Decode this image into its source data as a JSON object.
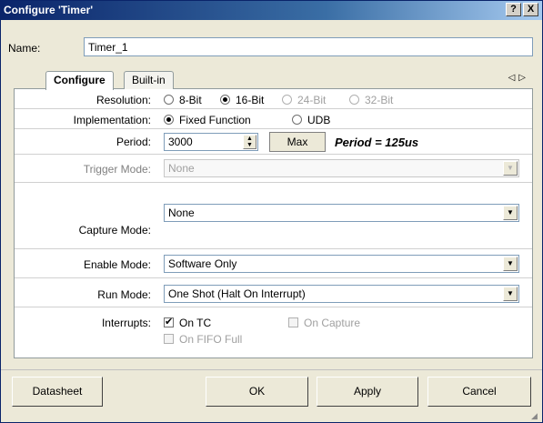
{
  "window": {
    "title": "Configure 'Timer'",
    "help_label": "?",
    "close_label": "X"
  },
  "name": {
    "label": "Name:",
    "value": "Timer_1"
  },
  "tabs": [
    {
      "label": "Configure"
    },
    {
      "label": "Built-in"
    }
  ],
  "tab_scroll": {
    "left": "◁",
    "right": "▷"
  },
  "rows": {
    "resolution": {
      "label": "Resolution:",
      "options": [
        "8-Bit",
        "16-Bit",
        "24-Bit",
        "32-Bit"
      ],
      "selected": "16-Bit"
    },
    "implementation": {
      "label": "Implementation:",
      "options": [
        "Fixed Function",
        "UDB"
      ],
      "selected": "Fixed Function"
    },
    "period": {
      "label": "Period:",
      "value": "3000",
      "max_label": "Max",
      "computed": "Period = 125us"
    },
    "trigger_mode": {
      "label": "Trigger Mode:",
      "value": "None"
    },
    "capture_mode": {
      "label": "Capture Mode:",
      "value": "None"
    },
    "enable_mode": {
      "label": "Enable Mode:",
      "value": "Software Only"
    },
    "run_mode": {
      "label": "Run Mode:",
      "value": "One Shot (Halt On Interrupt)"
    },
    "interrupts": {
      "label": "Interrupts:",
      "on_tc": "On TC",
      "on_capture": "On Capture",
      "on_fifo_full": "On FIFO Full"
    }
  },
  "buttons": {
    "datasheet": "Datasheet",
    "ok": "OK",
    "apply": "Apply",
    "cancel": "Cancel"
  },
  "icons": {
    "dropdown": "▼",
    "spin_up": "▲",
    "spin_down": "▼"
  }
}
